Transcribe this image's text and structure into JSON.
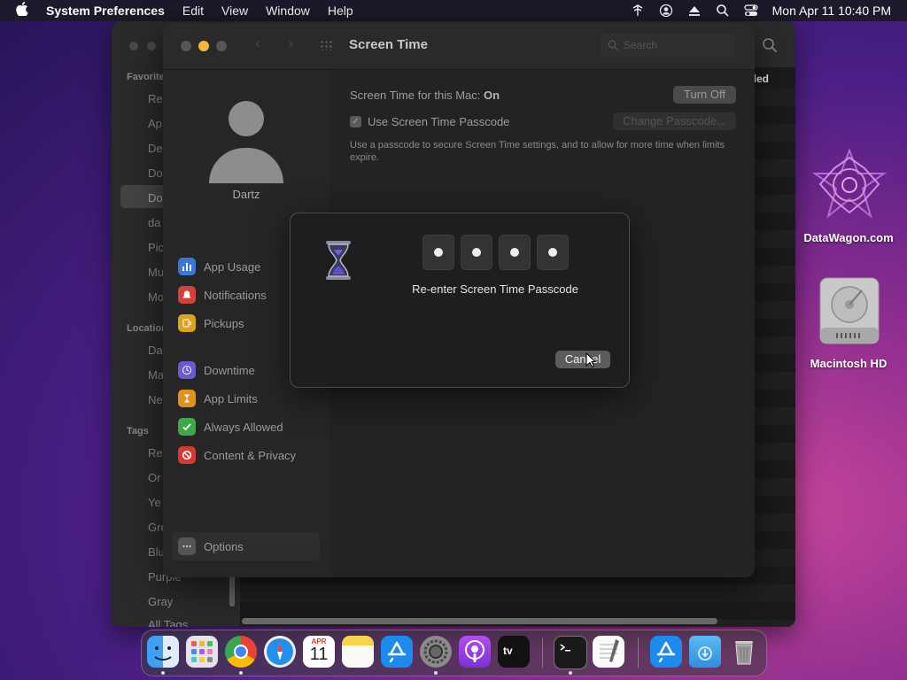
{
  "menubar": {
    "apple_icon": "apple-icon",
    "app_name": "System Preferences",
    "menus": [
      "Edit",
      "View",
      "Window",
      "Help"
    ],
    "clock": "Mon Apr 11  10:40 PM"
  },
  "finder": {
    "sidebar": {
      "favorites_header": "Favorite",
      "favorites": [
        "Re",
        "Ap",
        "De",
        "Do",
        "Do",
        "da",
        "Pic",
        "Mu",
        "Mo"
      ],
      "locations_header": "Location",
      "locations": [
        "Da",
        "Ma",
        "Ne"
      ],
      "tags_header": "Tags",
      "tags": [
        "Re",
        "Or",
        "Ye",
        "Gre",
        "Blu",
        "Purple",
        "Gray",
        "All Tags..."
      ]
    },
    "column_header": "led"
  },
  "screen_time": {
    "title": "Screen Time",
    "search_placeholder": "Search",
    "user_name": "Dartz",
    "nav_items": [
      {
        "label": "App Usage",
        "icon": "bar-chart-icon",
        "color": "#3a78d6"
      },
      {
        "label": "Notifications",
        "icon": "bell-icon",
        "color": "#d0433a"
      },
      {
        "label": "Pickups",
        "icon": "pickups-icon",
        "color": "#d9a321"
      },
      {
        "label": "Downtime",
        "icon": "moon-clock-icon",
        "color": "#6a5bd0"
      },
      {
        "label": "App Limits",
        "icon": "hourglass-icon",
        "color": "#e0921e"
      },
      {
        "label": "Always Allowed",
        "icon": "checkmark-icon",
        "color": "#3fa84a"
      },
      {
        "label": "Content & Privacy",
        "icon": "prohibited-icon",
        "color": "#d53a30"
      }
    ],
    "options_label": "Options",
    "status_label": "Screen Time for this Mac:",
    "status_value": "On",
    "turn_off_label": "Turn Off",
    "passcode_checkbox_label": "Use Screen Time Passcode",
    "passcode_checked": true,
    "change_passcode_label": "Change Passcode...",
    "description": "Use a passcode to secure Screen Time settings, and to allow for more time when limits expire.",
    "help_label": "?"
  },
  "modal": {
    "prompt": "Re-enter Screen Time Passcode",
    "digits_entered": 4,
    "cancel_label": "Cancel"
  },
  "desktop": {
    "icons": [
      {
        "label": "DataWagon.com"
      },
      {
        "label": "Macintosh HD"
      }
    ]
  },
  "dock": {
    "calendar_month": "APR",
    "calendar_day": "11",
    "tv_label": "tv",
    "items": [
      "Finder",
      "Launchpad",
      "Chrome",
      "Safari",
      "Calendar",
      "Notes",
      "App Store",
      "System Preferences",
      "Podcasts",
      "TV",
      "Terminal",
      "TextEdit",
      "App Store",
      "Downloads",
      "Trash"
    ]
  }
}
